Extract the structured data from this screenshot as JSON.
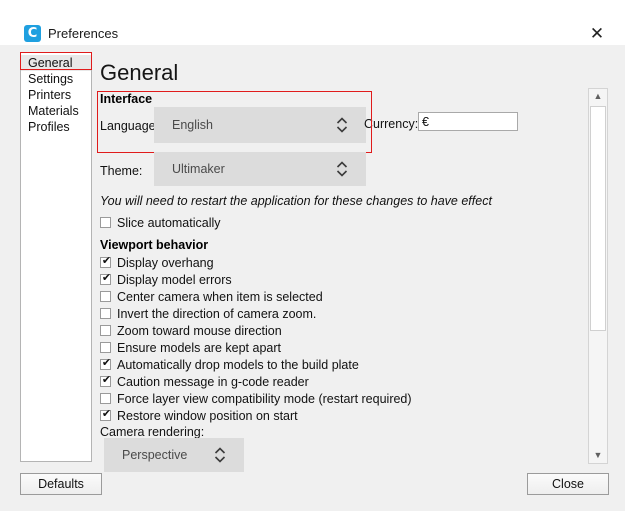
{
  "window": {
    "title": "Preferences",
    "app_icon": "cura-logo-icon",
    "app_icon_glyph": "C",
    "close_icon": "✕",
    "accent_color": "#1fa0e0",
    "annotation_color": "#e01b1b"
  },
  "sidebar": {
    "items": [
      {
        "label": "General",
        "selected": true
      },
      {
        "label": "Settings",
        "selected": false
      },
      {
        "label": "Printers",
        "selected": false
      },
      {
        "label": "Materials",
        "selected": false
      },
      {
        "label": "Profiles",
        "selected": false
      }
    ]
  },
  "main": {
    "page_title": "General",
    "interface": {
      "heading": "Interface",
      "language_label": "Language:",
      "language_value": "English",
      "currency_label": "Currency:",
      "currency_value": "€",
      "theme_label": "Theme:",
      "theme_value": "Ultimaker",
      "restart_note": "You will need to restart the application for these changes to have effect"
    },
    "slice_automatically": {
      "label": "Slice automatically",
      "checked": false
    },
    "viewport": {
      "heading": "Viewport behavior",
      "options": [
        {
          "label": "Display overhang",
          "checked": true
        },
        {
          "label": "Display model errors",
          "checked": true
        },
        {
          "label": "Center camera when item is selected",
          "checked": false
        },
        {
          "label": "Invert the direction of camera zoom.",
          "checked": false
        },
        {
          "label": "Zoom toward mouse direction",
          "checked": false
        },
        {
          "label": "Ensure models are kept apart",
          "checked": false
        },
        {
          "label": "Automatically drop models to the build plate",
          "checked": true
        },
        {
          "label": "Caution message in g-code reader",
          "checked": true
        },
        {
          "label": "Force layer view compatibility mode (restart required)",
          "checked": false
        },
        {
          "label": "Restore window position on start",
          "checked": true
        }
      ]
    },
    "camera": {
      "label": "Camera rendering:",
      "value": "Perspective"
    }
  },
  "scrollbar": {
    "up_icon": "▲",
    "down_icon": "▼"
  },
  "footer": {
    "defaults_label": "Defaults",
    "close_label": "Close"
  }
}
